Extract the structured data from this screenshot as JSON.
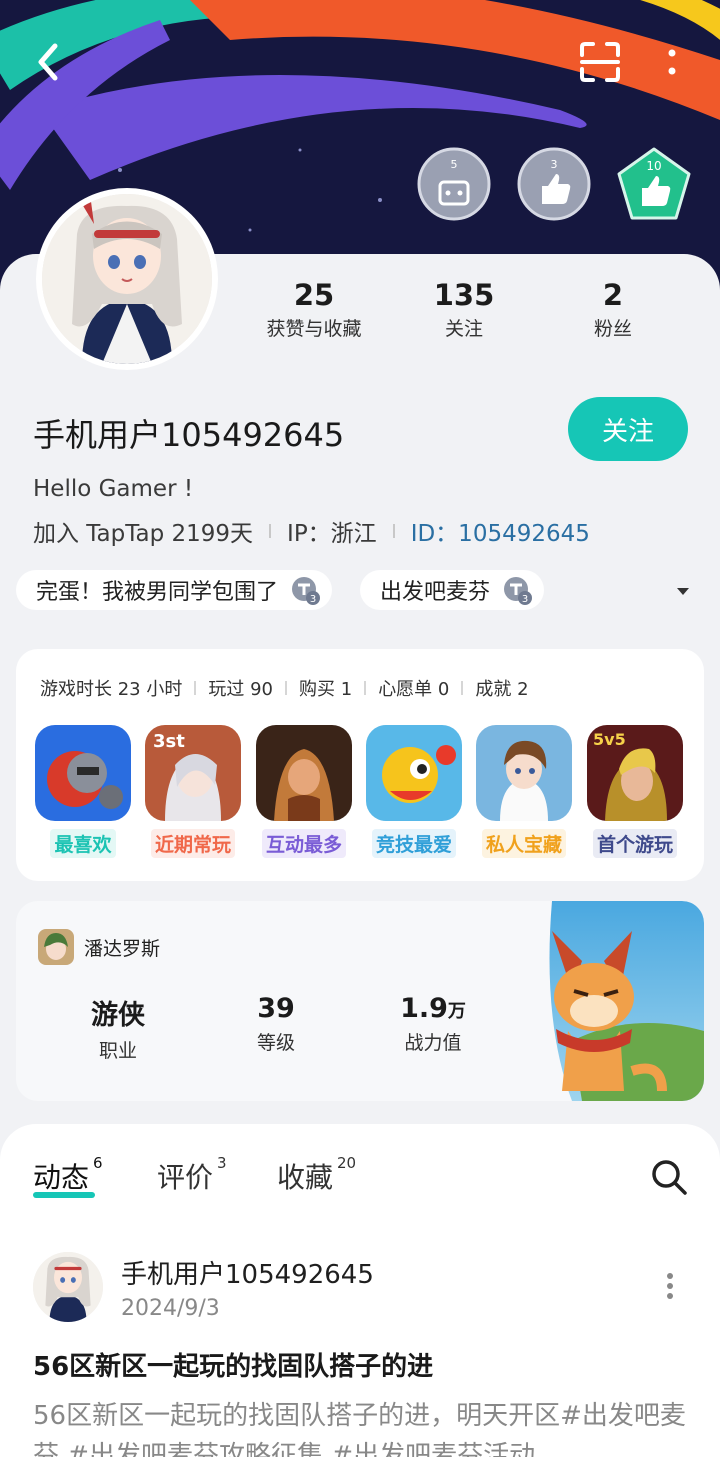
{
  "header": {
    "badges": [
      {
        "icon": "gamepad-badge-icon",
        "count": "5"
      },
      {
        "icon": "thumbs-up-badge-icon",
        "count": "3"
      },
      {
        "icon": "thumbs-up-green-badge-icon",
        "count": "10"
      }
    ]
  },
  "stats": [
    {
      "value": "25",
      "label": "获赞与收藏"
    },
    {
      "value": "135",
      "label": "关注"
    },
    {
      "value": "2",
      "label": "粉丝"
    }
  ],
  "profile": {
    "username": "手机用户105492645",
    "follow_label": "关注",
    "bio": "Hello Gamer !",
    "joined": "加入 TapTap 2199天",
    "ip": "IP：浙江",
    "id": "ID：105492645"
  },
  "tags": [
    {
      "label": "完蛋！我被男同学包围了"
    },
    {
      "label": "出发吧麦芬"
    }
  ],
  "games_stats": [
    "游戏时长 23 小时",
    "玩过 90",
    "购买 1",
    "心愿单 0",
    "成就 2"
  ],
  "games": [
    {
      "label": "最喜欢",
      "color": "#1cc3b3",
      "bg": "#e4f8f5"
    },
    {
      "label": "近期常玩",
      "color": "#f0684a",
      "bg": "#fdece8"
    },
    {
      "label": "互动最多",
      "color": "#7a5cd6",
      "bg": "#efeafb"
    },
    {
      "label": "竞技最爱",
      "color": "#2f9fd8",
      "bg": "#e5f3fb"
    },
    {
      "label": "私人宝藏",
      "color": "#f0a11c",
      "bg": "#fdf3e0"
    },
    {
      "label": "首个游玩",
      "color": "#3f4a8c",
      "bg": "#e9ebf4"
    }
  ],
  "character": {
    "game": "潘达罗斯",
    "stats": [
      {
        "value": "游侠",
        "unit": "",
        "label": "职业"
      },
      {
        "value": "39",
        "unit": "",
        "label": "等级"
      },
      {
        "value": "1.9",
        "unit": "万",
        "label": "战力值"
      }
    ]
  },
  "feed": {
    "tabs": [
      {
        "label": "动态",
        "count": "6"
      },
      {
        "label": "评价",
        "count": "3"
      },
      {
        "label": "收藏",
        "count": "20"
      }
    ],
    "post": {
      "user": "手机用户105492645",
      "date": "2024/9/3",
      "title": "56区新区一起玩的找固队搭子的进",
      "body": "56区新区一起玩的找固队搭子的进，明天开区#出发吧麦芬 #出发吧麦芬攻略征集 #出发吧麦芬活动"
    }
  }
}
